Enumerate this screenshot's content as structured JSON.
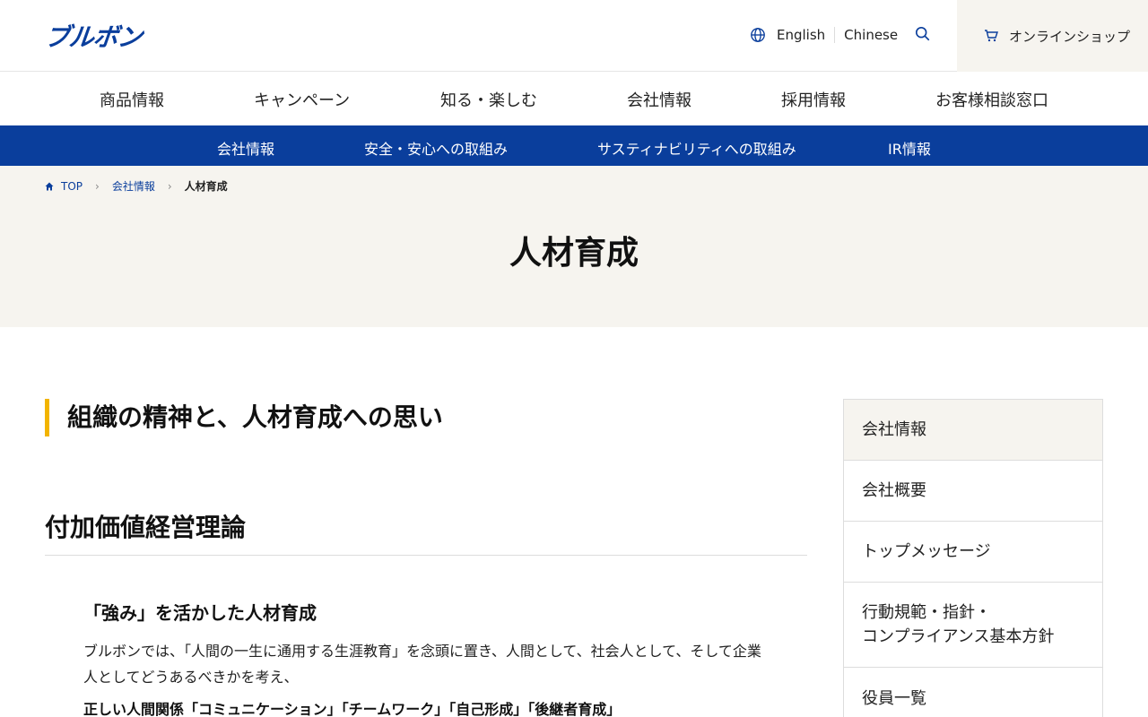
{
  "brand": {
    "logo_text": "ブルボン"
  },
  "header": {
    "lang_en": "English",
    "lang_cn": "Chinese",
    "shop_label": "オンラインショップ"
  },
  "main_nav": [
    "商品情報",
    "キャンペーン",
    "知る・楽しむ",
    "会社情報",
    "採用情報",
    "お客様相談窓口"
  ],
  "sub_nav": [
    "会社情報",
    "安全・安心への取組み",
    "サスティナビリティへの取組み",
    "IR情報"
  ],
  "breadcrumb": {
    "top": "TOP",
    "level1": "会社情報",
    "current": "人材育成"
  },
  "page_title": "人材育成",
  "content": {
    "section_title": "組織の精神と、人材育成への思い",
    "subsection_title": "付加価値経営理論",
    "heading": "「強み」を活かした人材育成",
    "paragraph": "ブルボンでは、「人間の一生に通用する生涯教育」を念頭に置き、人間として、社会人として、そして企業人としてどうあるべきかを考え、",
    "strong_line": "正しい人間関係「コミュニケーション」「チームワーク」「自己形成」「後継者育成」"
  },
  "sidebar": {
    "header": "会社情報",
    "items": [
      "会社概要",
      "トップメッセージ",
      "行動規範・指針・\nコンプライアンス基本方針",
      "役員一覧"
    ]
  },
  "colors": {
    "brand_blue": "#0a3e9c",
    "accent_yellow": "#f2b400",
    "hero_bg": "#f6f4ef"
  }
}
